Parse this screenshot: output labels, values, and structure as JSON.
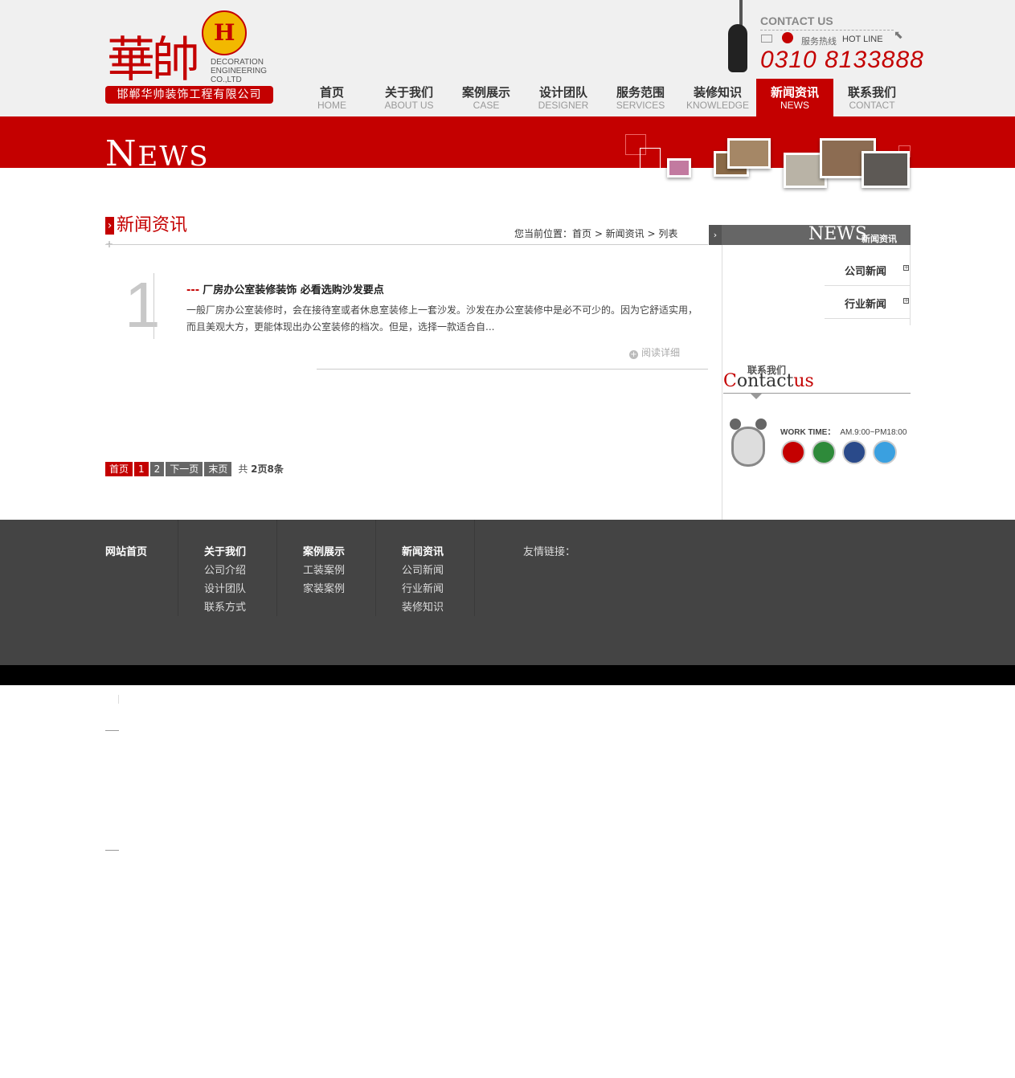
{
  "brand": {
    "logo_hanzi": "華帥",
    "logo_mark": "H",
    "logo_en": [
      "DECORATION",
      "ENGINEERING",
      "CO.,LTD"
    ],
    "company_name": "邯郸华帅装饰工程有限公司"
  },
  "contact_top": {
    "title": "CONTACT US",
    "hotline_cn": "服务热线",
    "hotline_en": "HOT LINE",
    "phone": "0310 8133888"
  },
  "nav": [
    {
      "cn": "首页",
      "en": "HOME",
      "active": false
    },
    {
      "cn": "关于我们",
      "en": "ABOUT US",
      "active": false
    },
    {
      "cn": "案例展示",
      "en": "CASE",
      "active": false
    },
    {
      "cn": "设计团队",
      "en": "DESIGNER",
      "active": false
    },
    {
      "cn": "服务范围",
      "en": "SERVICES",
      "active": false
    },
    {
      "cn": "装修知识",
      "en": "KNOWLEDGE",
      "active": false
    },
    {
      "cn": "新闻资讯",
      "en": "NEWS",
      "active": true
    },
    {
      "cn": "联系我们",
      "en": "CONTACT",
      "active": false
    }
  ],
  "banner": {
    "title_big": "N",
    "title_rest": "EWS"
  },
  "section": {
    "title": "新闻资讯",
    "breadcrumb": "您当前位置：首页 > 新闻资讯 > 列表"
  },
  "articles": [
    {
      "num": "1",
      "dash": "---",
      "title": "厂房办公室装修装饰 必看选购沙发要点",
      "excerpt": "一般厂房办公室装修时，会在接待室或者休息室装修上一套沙发。沙发在办公室装修中是必不可少的。因为它舒适实用，而且美观大方，更能体现出办公室装修的档次。但是，选择一款适合自...",
      "read_more": "阅读详细"
    }
  ],
  "pager": {
    "first": "首页",
    "pages": [
      "1",
      "2"
    ],
    "next": "下一页",
    "last": "末页",
    "info_prefix": "共",
    "info_value": "2页8条"
  },
  "sidebar": {
    "head_en": "NEWS",
    "head_cn": "新闻资讯",
    "links": [
      "公司新闻",
      "行业新闻"
    ],
    "contact_small": "联系我们",
    "contact_big_c": "C",
    "contact_big_mid": "ontact",
    "contact_big_us": "us",
    "worktime_label": "WORK TIME：",
    "worktime_value": "AM.9:00~PM18:00"
  },
  "footer": {
    "col1": {
      "head": "网站首页",
      "links": []
    },
    "col2": {
      "head": "关于我们",
      "links": [
        "公司介绍",
        "设计团队",
        "联系方式"
      ]
    },
    "col3": {
      "head": "案例展示",
      "links": [
        "工装案例",
        "家装案例"
      ]
    },
    "col4": {
      "head": "新闻资讯",
      "links": [
        "公司新闻",
        "行业新闻",
        "装修知识"
      ]
    },
    "friends": "友情链接："
  },
  "colors": {
    "brand_red": "#c40000",
    "footer_bg": "#444444",
    "footer_bottom": "#000000"
  }
}
